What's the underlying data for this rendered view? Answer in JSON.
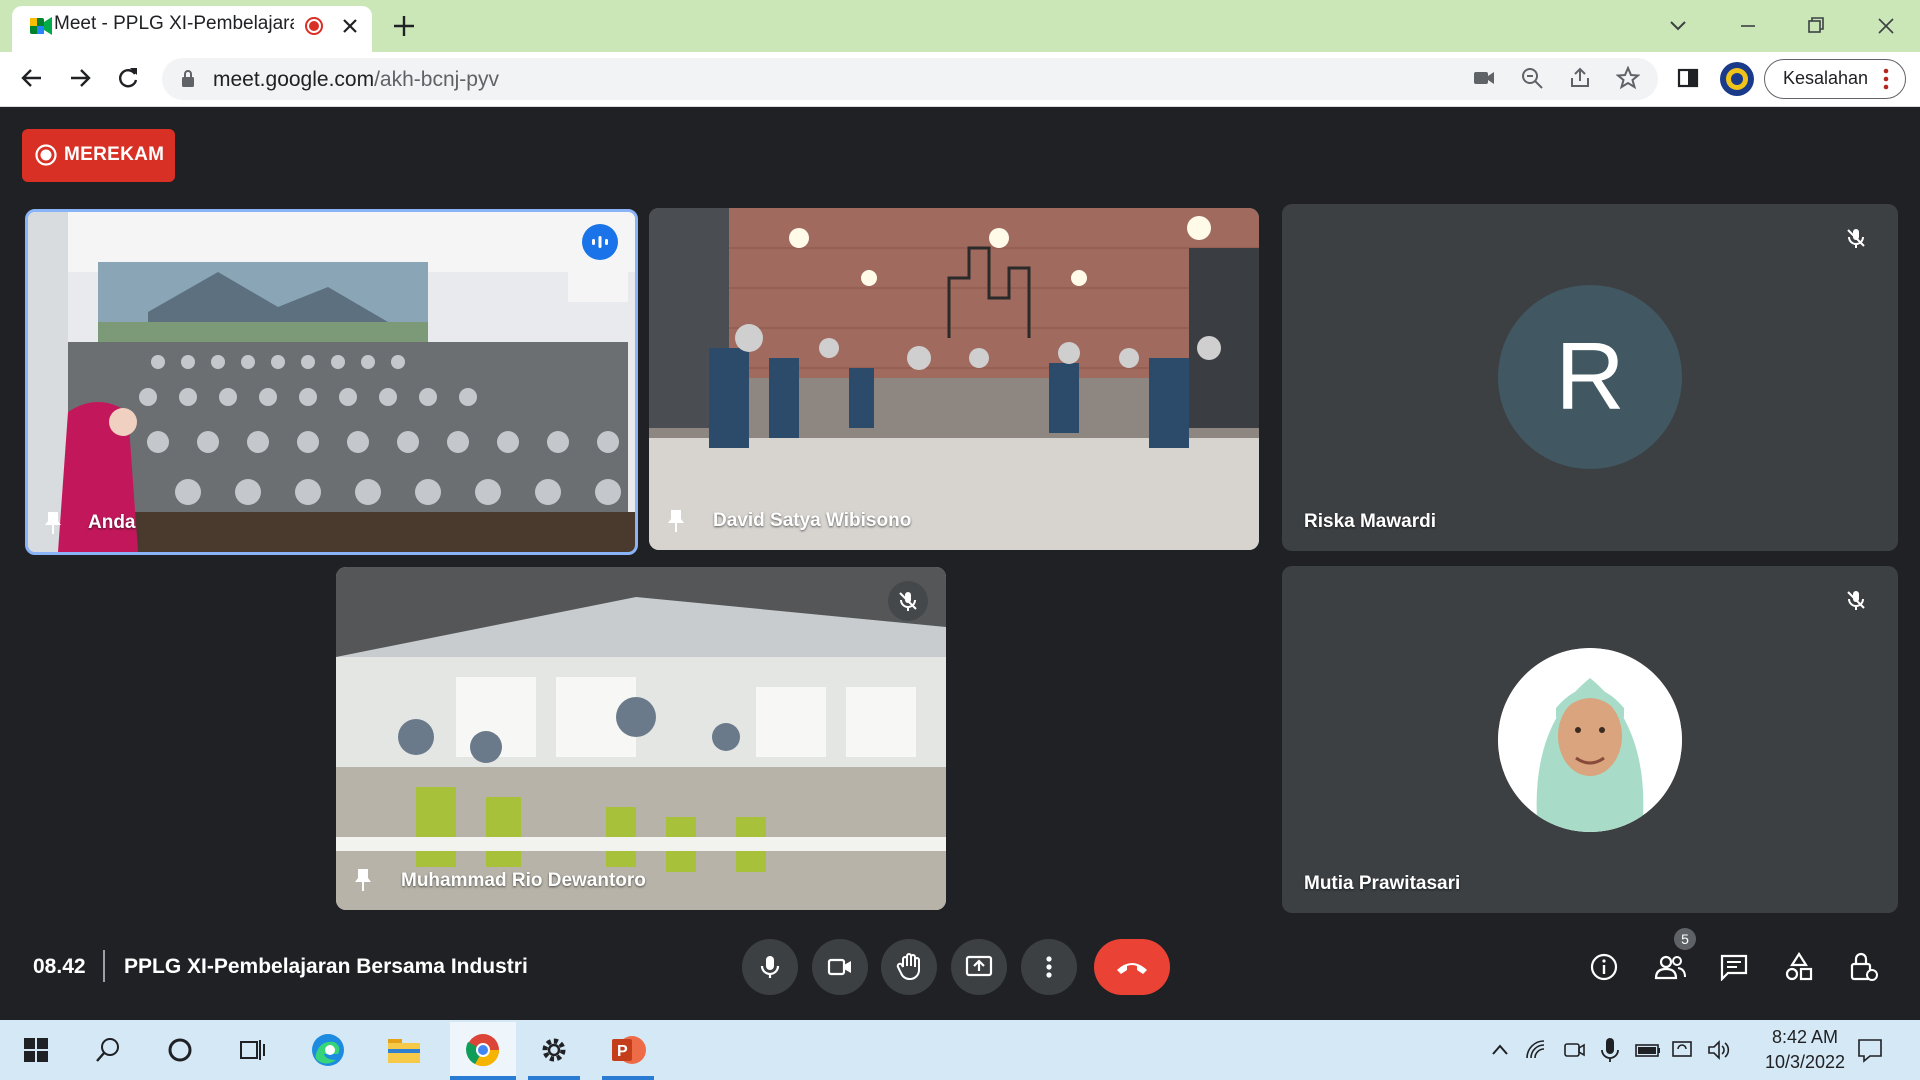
{
  "browser": {
    "tab_title": "Meet - PPLG XI-Pembelajaran Bersama Industri",
    "new_tab_icon": "plus-icon",
    "url_host": "meet.google.com",
    "url_path": "/akh-bcnj-pyv",
    "profile_label": "Kesalahan"
  },
  "meet": {
    "recording_label": "MEREKAM",
    "meeting_time": "08.42",
    "meeting_title": "PPLG XI-Pembelajaran Bersama Industri",
    "participants": [
      {
        "name": "Anda",
        "type": "video",
        "speaking": true
      },
      {
        "name": "David Satya Wibisono",
        "type": "video"
      },
      {
        "name": "Riska Mawardi",
        "type": "avatar",
        "initial": "R",
        "muted": true
      },
      {
        "name": "Muhammad Rio Dewantoro",
        "type": "video",
        "muted": true
      },
      {
        "name": "Mutia Prawitasari",
        "type": "photo",
        "muted": true
      }
    ],
    "people_count": "5",
    "controls": [
      "mic-icon",
      "camera-icon",
      "raise-hand-icon",
      "present-screen-icon",
      "more-options-icon",
      "end-call-icon"
    ],
    "side_controls": [
      "info-icon",
      "people-icon",
      "chat-icon",
      "activities-icon",
      "host-controls-icon"
    ]
  },
  "taskbar": {
    "time": "8:42 AM",
    "date": "10/3/2022",
    "apps": [
      "start-icon",
      "search-icon",
      "cortana-icon",
      "task-view-icon",
      "edge-icon",
      "file-explorer-icon",
      "chrome-icon",
      "settings-icon",
      "powerpoint-icon"
    ]
  },
  "colors": {
    "meet_bg": "#202124",
    "tile_bg": "#3c4043",
    "end_call": "#ea4335",
    "recording": "#d93025",
    "tab_strip": "#cbe7b8",
    "speaking_border": "#8ab4f8",
    "avatar_r": "#415862"
  }
}
